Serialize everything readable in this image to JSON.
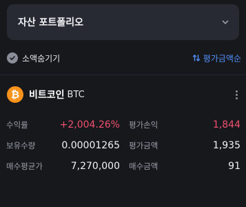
{
  "dropdown": {
    "label": "자산 포트폴리오",
    "icon": "chevron-down-icon"
  },
  "toolbar": {
    "hide_small_label": "소액숨기기",
    "sort_label": "평가금액순",
    "accent_color": "#4f8ef7"
  },
  "coin": {
    "name": "비트코인",
    "symbol": "BTC",
    "logo_glyph": "₿",
    "logo_color": "#f7931a",
    "stats": {
      "yield_label": "수익률",
      "yield_value": "+2,004.26%",
      "pnl_label": "평가손익",
      "pnl_value": "1,844",
      "qty_label": "보유수량",
      "qty_value": "0.00001265",
      "eval_label": "평가금액",
      "eval_value": "1,935",
      "avg_label": "매수평균가",
      "avg_value": "7,270,000",
      "buy_label": "매수금액",
      "buy_value": "91"
    },
    "positive_color": "#f0506e"
  }
}
